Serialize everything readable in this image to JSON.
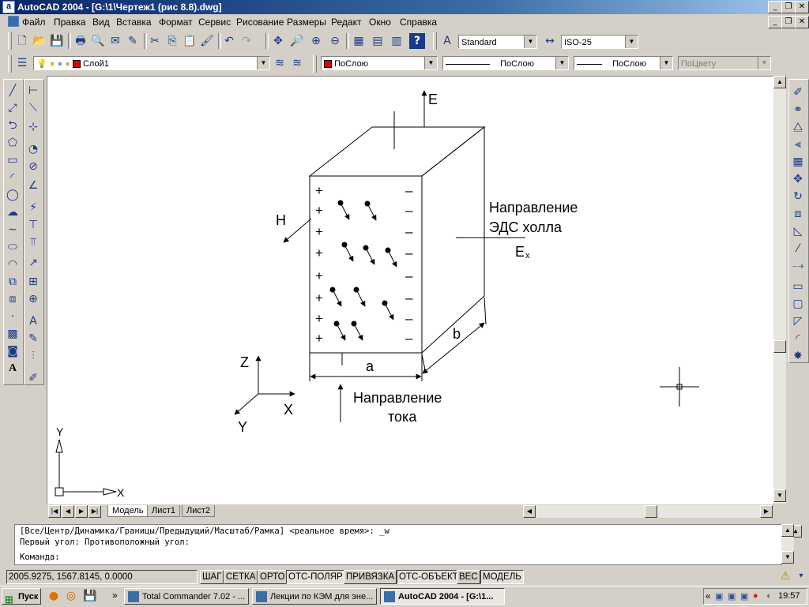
{
  "window": {
    "title": "AutoCAD 2004 - [G:\\1\\Чертеж1 (рис 8.8).dwg]",
    "app_icon": "a",
    "controls": [
      "_",
      "❐",
      "✕"
    ]
  },
  "menu": [
    "Файл",
    "Правка",
    "Вид",
    "Вставка",
    "Формат",
    "Сервис",
    "Рисование",
    "Размеры",
    "Редакт",
    "Окно",
    "Справка"
  ],
  "toolbar": {
    "text_style": "Standard",
    "dim_style": "ISO-25"
  },
  "layers": {
    "layer": "Слой1",
    "color": "ПоСлою",
    "linetype": "ПоСлою",
    "lineweight": "ПоСлою",
    "plotstyle": "ПоЦвету",
    "layer_color_hex": "#e00000"
  },
  "drawing": {
    "label_E": "E",
    "label_H": "H",
    "label_hall_1": "Направление",
    "label_hall_2": "ЭДС холла",
    "label_Ex": "E",
    "label_Ex_sub": "x",
    "label_b": "b",
    "label_a": "a",
    "label_Z": "Z",
    "label_X": "X",
    "label_Y": "Y",
    "label_cur_1": "Направление",
    "label_cur_2": "тока",
    "ucs_x": "X",
    "ucs_y": "Y",
    "plus": "+",
    "minus": "–"
  },
  "tabs": [
    "Модель",
    "Лист1",
    "Лист2"
  ],
  "command": {
    "line1": "[Все/Центр/Динамика/Границы/Предыдущий/Масштаб/Рамка] <реальное время>: _w",
    "line2": "Первый угол: Противоположный угол:",
    "prompt": "Команда:"
  },
  "status": {
    "coords": "2005.9275, 1567.8145, 0.0000",
    "buttons": [
      {
        "label": "ШАГ",
        "on": false
      },
      {
        "label": "СЕТКА",
        "on": false
      },
      {
        "label": "ОРТО",
        "on": false
      },
      {
        "label": "ОТС-ПОЛЯР",
        "on": true
      },
      {
        "label": "ПРИВЯЗКА",
        "on": false
      },
      {
        "label": "ОТС-ОБЪЕКТ",
        "on": true
      },
      {
        "label": "ВЕС",
        "on": false
      },
      {
        "label": "МОДЕЛЬ",
        "on": true
      }
    ]
  },
  "taskbar": {
    "start": "Пуск",
    "tasks": [
      "Total Commander 7.02 - ...",
      "Лекции по КЭМ для эне...",
      "AutoCAD 2004 - [G:\\1..."
    ],
    "clock": "19:57"
  }
}
